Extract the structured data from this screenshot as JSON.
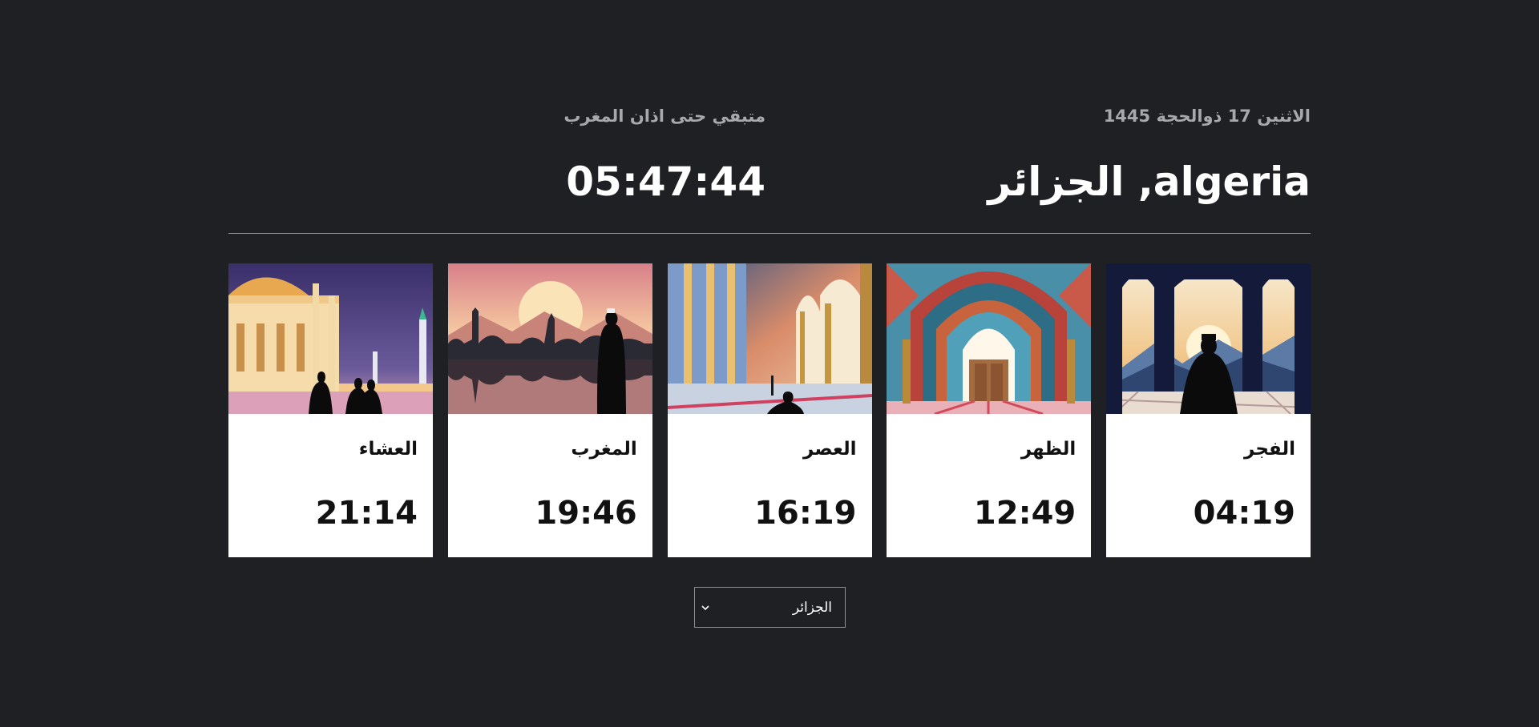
{
  "header": {
    "hijri_date": "الاثنين 17 ذوالحجة 1445",
    "location": "algeria, الجزائر",
    "countdown_label": "متبقي حتى اذان المغرب",
    "countdown": "05:47:44"
  },
  "prayers": [
    {
      "name": "الفجر",
      "time": "04:19",
      "image": "fajr-image"
    },
    {
      "name": "الظهر",
      "time": "12:49",
      "image": "dhuhr-image"
    },
    {
      "name": "العصر",
      "time": "16:19",
      "image": "asr-image"
    },
    {
      "name": "المغرب",
      "time": "19:46",
      "image": "maghrib-image"
    },
    {
      "name": "العشاء",
      "time": "21:14",
      "image": "isha-image"
    }
  ],
  "city_select": {
    "value": "الجزائر",
    "icon": "chevron-down-icon"
  },
  "colors": {
    "background": "#1f2023",
    "card": "#ffffff",
    "muted_text": "#a7a8ac"
  }
}
